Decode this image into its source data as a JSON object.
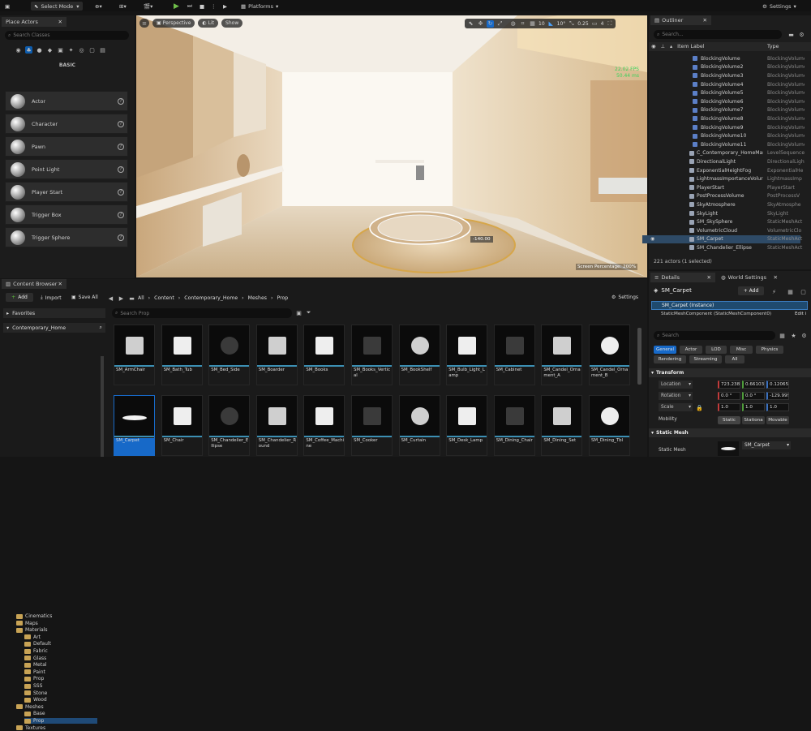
{
  "topbar": {
    "select_mode": "Select Mode",
    "platforms": "Platforms",
    "settings": "Settings"
  },
  "place_actors": {
    "tab": "Place Actors",
    "search_placeholder": "Search Classes",
    "section": "BASIC",
    "items": [
      {
        "label": "Actor",
        "icon": "sphere-icon"
      },
      {
        "label": "Character",
        "icon": "character-icon"
      },
      {
        "label": "Pawn",
        "icon": "pawn-icon"
      },
      {
        "label": "Point Light",
        "icon": "light-bulb-icon"
      },
      {
        "label": "Player Start",
        "icon": "flag-icon"
      },
      {
        "label": "Trigger Box",
        "icon": "box-icon"
      },
      {
        "label": "Trigger Sphere",
        "icon": "sphere-icon"
      }
    ]
  },
  "viewport": {
    "perspective": "Perspective",
    "lit": "Lit",
    "show": "Show",
    "snap_angle": "10",
    "snap_rot": "10°",
    "scale_snap": "0.25",
    "camera_speed": "4",
    "fps": "22.02 FPS",
    "ms": "50.44 ms",
    "rotation_readout": "-140.00",
    "screen_pct": "Screen Percentage: 200%"
  },
  "outliner": {
    "tab": "Outliner",
    "search_placeholder": "Search...",
    "col_label": "Item Label",
    "col_type": "Type",
    "rows": [
      {
        "name": "BlockingVolume",
        "type": "BlockingVolume"
      },
      {
        "name": "BlockingVolume2",
        "type": "BlockingVolume"
      },
      {
        "name": "BlockingVolume3",
        "type": "BlockingVolume"
      },
      {
        "name": "BlockingVolume4",
        "type": "BlockingVolume"
      },
      {
        "name": "BlockingVolume5",
        "type": "BlockingVolume"
      },
      {
        "name": "BlockingVolume6",
        "type": "BlockingVolume"
      },
      {
        "name": "BlockingVolume7",
        "type": "BlockingVolume"
      },
      {
        "name": "BlockingVolume8",
        "type": "BlockingVolume"
      },
      {
        "name": "BlockingVolume9",
        "type": "BlockingVolume"
      },
      {
        "name": "BlockingVolume10",
        "type": "BlockingVolume"
      },
      {
        "name": "BlockingVolume11",
        "type": "BlockingVolume"
      },
      {
        "name": "C_Contemporary_HomeMas",
        "type": "LevelSequence"
      },
      {
        "name": "DirectionalLight",
        "type": "DirectionalLight"
      },
      {
        "name": "ExponentialHeightFog",
        "type": "ExponentialHe"
      },
      {
        "name": "LightmassImportanceVolur",
        "type": "LightmassImp"
      },
      {
        "name": "PlayerStart",
        "type": "PlayerStart"
      },
      {
        "name": "PostProcessVolume",
        "type": "PostProcessV"
      },
      {
        "name": "SkyAtmosphere",
        "type": "SkyAtmosphe"
      },
      {
        "name": "SkyLight",
        "type": "SkyLight"
      },
      {
        "name": "SM_SkySphere",
        "type": "StaticMeshAct"
      },
      {
        "name": "VolumetricCloud",
        "type": "VolumetricClo"
      },
      {
        "name": "SM_Carpet",
        "type": "StaticMeshAct"
      },
      {
        "name": "SM_Chandelier_Ellipse",
        "type": "StaticMeshAct"
      }
    ],
    "status": "221 actors (1 selected)"
  },
  "details": {
    "tab": "Details",
    "tab2": "World Settings",
    "object_name": "SM_Carpet",
    "add": "+ Add",
    "instance": "SM_Carpet (Instance)",
    "component": "StaticMeshComponent (StaticMeshComponent0)",
    "edit": "Edit i",
    "search_placeholder": "Search",
    "filters": [
      "General",
      "Actor",
      "LOD",
      "Misc",
      "Physics",
      "Rendering",
      "Streaming",
      "All"
    ],
    "transform_header": "Transform",
    "location_label": "Location",
    "location": [
      "723.238",
      "0.661037",
      "0.120651"
    ],
    "rotation_label": "Rotation",
    "rotation": [
      "0.0 °",
      "0.0 °",
      "-129.999"
    ],
    "scale_label": "Scale",
    "scale": [
      "1.0",
      "1.0",
      "1.0"
    ],
    "mobility_label": "Mobility",
    "mobility": [
      "Static",
      "Stationa",
      "Movable"
    ],
    "static_mesh_header": "Static Mesh",
    "static_mesh_label": "Static Mesh",
    "static_mesh_value": "SM_Carpet"
  },
  "content_browser": {
    "tab": "Content Browser",
    "add": "Add",
    "import": "Import",
    "save_all": "Save All",
    "path": [
      "All",
      "Content",
      "Contemporary_Home",
      "Meshes",
      "Prop"
    ],
    "settings": "Settings",
    "search_placeholder": "Search Prop",
    "favorites": "Favorites",
    "root": "Contemporary_Home",
    "folders": [
      {
        "label": "Cinematics",
        "indent": 1
      },
      {
        "label": "Maps",
        "indent": 1
      },
      {
        "label": "Materials",
        "indent": 1
      },
      {
        "label": "Art",
        "indent": 2
      },
      {
        "label": "Default",
        "indent": 2
      },
      {
        "label": "Fabric",
        "indent": 2
      },
      {
        "label": "Glass",
        "indent": 2
      },
      {
        "label": "Metal",
        "indent": 2
      },
      {
        "label": "Paint",
        "indent": 2
      },
      {
        "label": "Prop",
        "indent": 2
      },
      {
        "label": "SSS",
        "indent": 2
      },
      {
        "label": "Stone",
        "indent": 2
      },
      {
        "label": "Wood",
        "indent": 2
      },
      {
        "label": "Meshes",
        "indent": 1
      },
      {
        "label": "Base",
        "indent": 2
      },
      {
        "label": "Prop",
        "indent": 2
      },
      {
        "label": "Textures",
        "indent": 1
      }
    ],
    "assets_row1": [
      "SM_ArmChair",
      "SM_Bath_Tub",
      "SM_Bed_Side",
      "SM_Boarder",
      "SM_Books",
      "SM_Books_Vertical",
      "SM_BookShelf",
      "SM_Bulb_Light_Lamp",
      "SM_Cabinet",
      "SM_Candel_Ornament_A",
      "SM_Candel_Ornament_B"
    ],
    "assets_row2": [
      "SM_Carpet",
      "SM_Chair",
      "SM_Chandelier_Ellipse",
      "SM_Chandelier_Round",
      "SM_Coffee_Machine",
      "SM_Cooker",
      "SM_Curtain",
      "SM_Desk_Lamp",
      "SM_Dining_Chair",
      "SM_Dining_Set",
      "SM_Dining_Tbl"
    ]
  }
}
